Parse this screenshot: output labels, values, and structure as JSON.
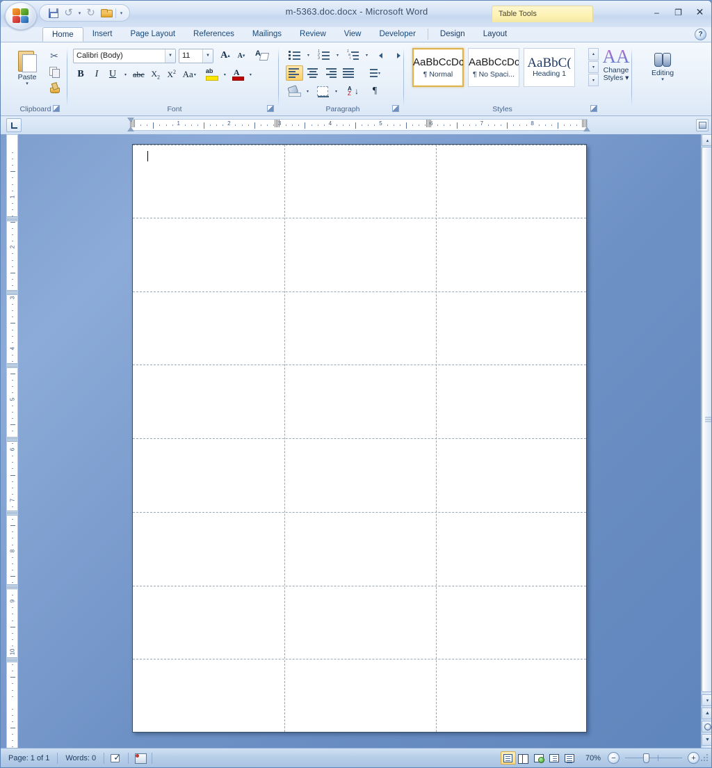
{
  "window": {
    "document_title": "m-5363.doc.docx - Microsoft Word",
    "contextual_tab_group": "Table Tools",
    "minimize": "–",
    "maximize": "❐",
    "close": "✕",
    "help": "?"
  },
  "quick_access": {
    "items": [
      {
        "name": "save-button",
        "icon": "save-icon",
        "label": "Save"
      },
      {
        "name": "undo-button",
        "icon": "undo-icon",
        "label": "Undo"
      },
      {
        "name": "undo-dropdown",
        "icon": "chevron-down-icon",
        "label": "▾"
      },
      {
        "name": "redo-button",
        "icon": "redo-icon",
        "label": "Redo"
      },
      {
        "name": "open-button",
        "icon": "open-folder-icon",
        "label": "Open"
      },
      {
        "name": "customize-qat-button",
        "icon": "chevron-down-icon",
        "label": "▾"
      }
    ]
  },
  "ribbon": {
    "tabs": [
      {
        "label": "Home",
        "active": true,
        "contextual": false
      },
      {
        "label": "Insert",
        "active": false,
        "contextual": false
      },
      {
        "label": "Page Layout",
        "active": false,
        "contextual": false
      },
      {
        "label": "References",
        "active": false,
        "contextual": false
      },
      {
        "label": "Mailings",
        "active": false,
        "contextual": false
      },
      {
        "label": "Review",
        "active": false,
        "contextual": false
      },
      {
        "label": "View",
        "active": false,
        "contextual": false
      },
      {
        "label": "Developer",
        "active": false,
        "contextual": false
      },
      {
        "label": "Design",
        "active": false,
        "contextual": true
      },
      {
        "label": "Layout",
        "active": false,
        "contextual": true
      }
    ],
    "groups": {
      "clipboard": {
        "label": "Clipboard",
        "paste": "Paste",
        "paste_caret": "▾",
        "cut": "Cut",
        "copy": "Copy",
        "format_painter": "Format Painter"
      },
      "font": {
        "label": "Font",
        "font_name": "Calibri (Body)",
        "font_size": "11",
        "grow_font": "A",
        "shrink_font": "A",
        "clear_formatting": "Clear Formatting",
        "bold": "B",
        "italic": "I",
        "underline": "U",
        "strikethrough": "abc",
        "subscript": "X",
        "superscript": "X",
        "change_case": "Aa",
        "highlight": "Text Highlight Color",
        "font_color": "A",
        "caret": "▾"
      },
      "paragraph": {
        "label": "Paragraph",
        "bullets": "Bullets",
        "numbering": "Numbering",
        "multilevel_list": "Multilevel List",
        "decrease_indent": "Decrease Indent",
        "increase_indent": "Increase Indent",
        "align_left": "Align Text Left",
        "align_center": "Center",
        "align_right": "Align Text Right",
        "justify": "Justify",
        "line_spacing": "Line Spacing",
        "shading": "Shading",
        "borders": "Borders",
        "sort": "Sort",
        "show_marks": "¶"
      },
      "styles": {
        "label": "Styles",
        "gallery": [
          {
            "sample": "AaBbCcDc",
            "name": "¶ Normal",
            "selected": true
          },
          {
            "sample": "AaBbCcDc",
            "name": "¶ No Spaci...",
            "selected": false
          },
          {
            "sample": "AaBbC(",
            "name": "Heading 1",
            "selected": false
          }
        ],
        "scroll_up": "▴",
        "scroll_down": "▾",
        "more": "▾",
        "change_styles_line1": "Change",
        "change_styles_line2": "Styles ▾"
      },
      "editing": {
        "label": "Editing",
        "title": "Editing",
        "caret": "▾"
      }
    }
  },
  "ruler": {
    "tab_stop_selector": "L",
    "horizontal_numbers": [
      "1",
      "2",
      "3",
      "4",
      "5",
      "6",
      "7",
      "8"
    ],
    "vertical_numbers": [
      "1",
      "2",
      "3",
      "4",
      "5",
      "6",
      "7",
      "8",
      "9",
      "10"
    ],
    "first_line_indent": "First Line Indent",
    "hanging_indent": "Hanging Indent",
    "right_indent": "Right Indent"
  },
  "document": {
    "table": {
      "rows": 8,
      "columns": 3,
      "gridline_style": "dashed"
    },
    "caret_visible": true
  },
  "scrollbars": {
    "scroll_up": "▴",
    "scroll_down": "▾",
    "previous_page": "⯅",
    "select_browse_object": "browse-object-icon",
    "next_page": "⯆"
  },
  "status_bar": {
    "page": "Page: 1 of 1",
    "words": "Words: 0",
    "proofing": "Proofing Errors",
    "language": "Language",
    "views": [
      {
        "name": "print-layout",
        "label": "Print Layout",
        "active": true
      },
      {
        "name": "full-screen-reading",
        "label": "Full Screen Reading",
        "active": false
      },
      {
        "name": "web-layout",
        "label": "Web Layout",
        "active": false
      },
      {
        "name": "outline",
        "label": "Outline",
        "active": false
      },
      {
        "name": "draft",
        "label": "Draft",
        "active": false
      }
    ],
    "zoom": "70%",
    "zoom_out": "−",
    "zoom_in": "+"
  },
  "colors": {
    "accent": "#1b3a5e",
    "contextual_tab": "#fdf3b4",
    "selection_gold": "#fdd067",
    "page_background": "#ffffff",
    "workspace": "#6e91c5"
  }
}
